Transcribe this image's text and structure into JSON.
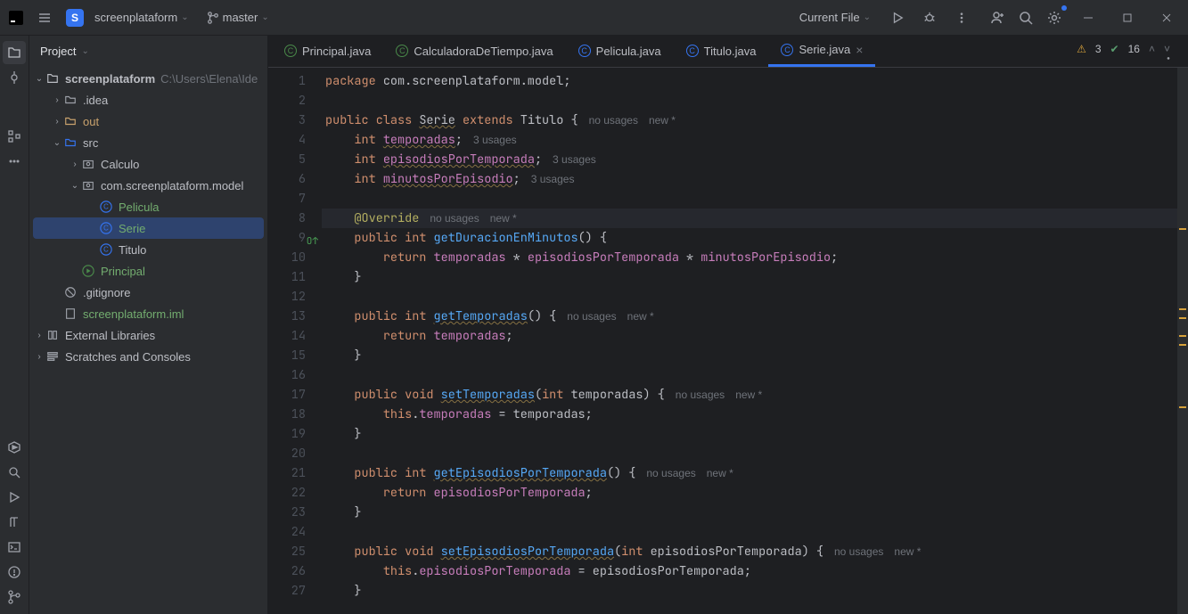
{
  "titlebar": {
    "project_initial": "S",
    "project_name": "screenplataform",
    "branch": "master",
    "run_config": "Current File"
  },
  "sidebar": {
    "title": "Project"
  },
  "tree": {
    "root": "screenplataform",
    "root_path": "C:\\Users\\Elena\\Ide",
    "idea": ".idea",
    "out": "out",
    "src": "src",
    "calculo": "Calculo",
    "pkg": "com.screenplataform.model",
    "pelicula": "Pelicula",
    "serie": "Serie",
    "titulo": "Titulo",
    "principal": "Principal",
    "gitignore": ".gitignore",
    "iml": "screenplataform.iml",
    "ext_lib": "External Libraries",
    "scratch": "Scratches and Consoles"
  },
  "tabs": [
    {
      "label": "Principal.java",
      "active": false
    },
    {
      "label": "CalculadoraDeTiempo.java",
      "active": false
    },
    {
      "label": "Pelicula.java",
      "active": false
    },
    {
      "label": "Titulo.java",
      "active": false
    },
    {
      "label": "Serie.java",
      "active": true
    }
  ],
  "status": {
    "warnings": "3",
    "checks": "16"
  },
  "hints": {
    "no_usages": "no usages",
    "new": "new *",
    "u3": "3 usages"
  },
  "code": {
    "l1_pkg": "package",
    "l1_path": "com.screenplataform.model",
    "l3_public": "public",
    "l3_class": "class",
    "l3_name": "Serie",
    "l3_extends": "extends",
    "l3_parent": "Titulo",
    "l4_int": "int",
    "l4_field": "temporadas",
    "l5_field": "episodiosPorTemporada",
    "l6_field": "minutosPorEpisodio",
    "l8_ann": "@Override",
    "l9_public": "public",
    "l9_int": "int",
    "l9_m": "getDuracionEnMinutos",
    "l10_return": "return",
    "l10_f1": "temporadas",
    "l10_f2": "episodiosPorTemporada",
    "l10_f3": "minutosPorEpisodio",
    "l13_m": "getTemporadas",
    "l14_f": "temporadas",
    "l17_void": "void",
    "l17_m": "setTemporadas",
    "l17_p": "temporadas",
    "l18_this": "this",
    "l18_f": "temporadas",
    "l21_m": "getEpisodiosPorTemporada",
    "l22_f": "episodiosPorTemporada",
    "l25_m": "setEpisodiosPorTemporada",
    "l25_p": "episodiosPorTemporada",
    "l26_f": "episodiosPorTemporada"
  }
}
